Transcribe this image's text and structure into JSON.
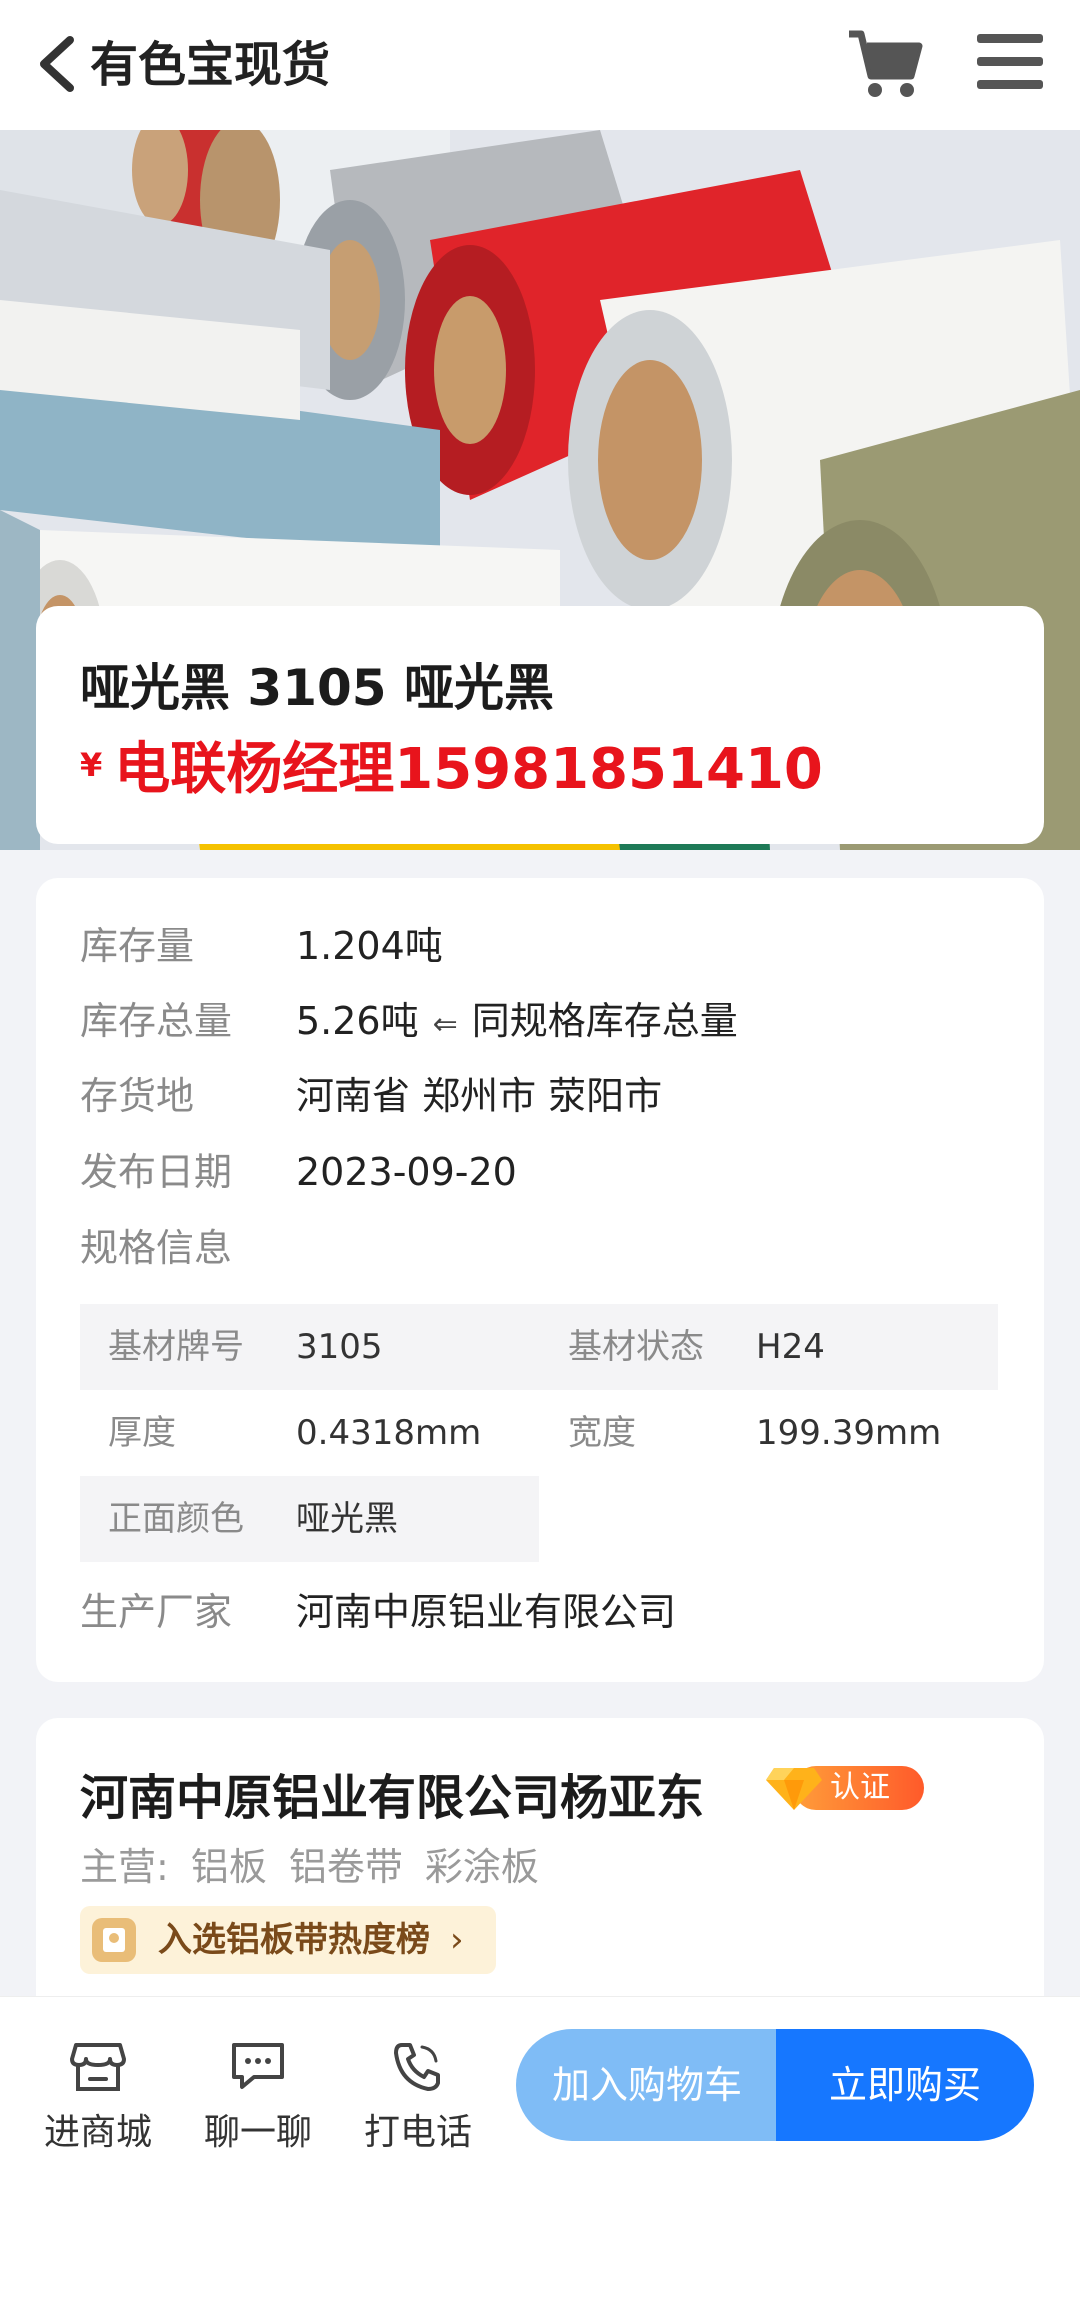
{
  "header": {
    "title": "有色宝现货"
  },
  "product": {
    "title": "哑光黑 3105 哑光黑",
    "currency": "¥",
    "price_text": "电联杨经理15981851410"
  },
  "info": {
    "stock_label": "库存量",
    "stock_value": "1.204吨",
    "total_label": "库存总量",
    "total_value": "5.26吨",
    "total_hint": "同规格库存总量",
    "location_label": "存货地",
    "location_value": "河南省 郑州市 荥阳市",
    "date_label": "发布日期",
    "date_value": "2023-09-20",
    "spec_label": "规格信息",
    "maker_label": "生产厂家",
    "maker_value": "河南中原铝业有限公司"
  },
  "spec": {
    "grade_label": "基材牌号",
    "grade_value": "3105",
    "state_label": "基材状态",
    "state_value": "H24",
    "thickness_label": "厚度",
    "thickness_value": "0.4318mm",
    "width_label": "宽度",
    "width_value": "199.39mm",
    "color_label": "正面颜色",
    "color_value": "哑光黑"
  },
  "seller": {
    "name": "河南中原铝业有限公司杨亚东",
    "badge": "认证",
    "main_label": "主营:",
    "main_items": [
      "铝板",
      "铝卷带",
      "彩涂板"
    ],
    "rank_text": "入选铝板带热度榜"
  },
  "bottom": {
    "shop": "进商城",
    "chat": "聊一聊",
    "call": "打电话",
    "add_cart": "加入购物车",
    "buy_now": "立即购买"
  },
  "colors": {
    "price": "#e8141c",
    "primary": "#1677ff",
    "cart_button": "#7fbcf6"
  }
}
